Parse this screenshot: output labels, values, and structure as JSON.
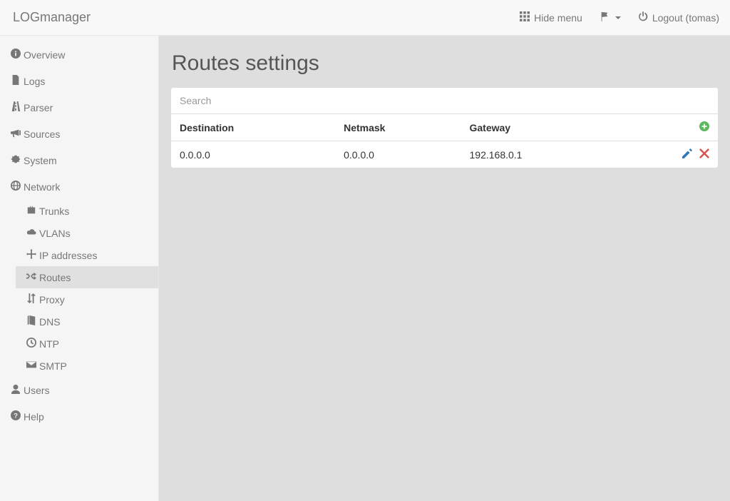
{
  "header": {
    "brand": "LOGmanager",
    "hide_menu": "Hide menu",
    "logout": "Logout (tomas)"
  },
  "sidebar": {
    "overview": "Overview",
    "logs": "Logs",
    "parser": "Parser",
    "sources": "Sources",
    "system": "System",
    "network": "Network",
    "network_sub": {
      "trunks": "Trunks",
      "vlans": "VLANs",
      "ip": "IP addresses",
      "routes": "Routes",
      "proxy": "Proxy",
      "dns": "DNS",
      "ntp": "NTP",
      "smtp": "SMTP"
    },
    "users": "Users",
    "help": "Help"
  },
  "main": {
    "title": "Routes settings",
    "search_placeholder": "Search",
    "columns": {
      "destination": "Destination",
      "netmask": "Netmask",
      "gateway": "Gateway"
    },
    "rows": [
      {
        "destination": "0.0.0.0",
        "netmask": "0.0.0.0",
        "gateway": "192.168.0.1"
      }
    ]
  }
}
